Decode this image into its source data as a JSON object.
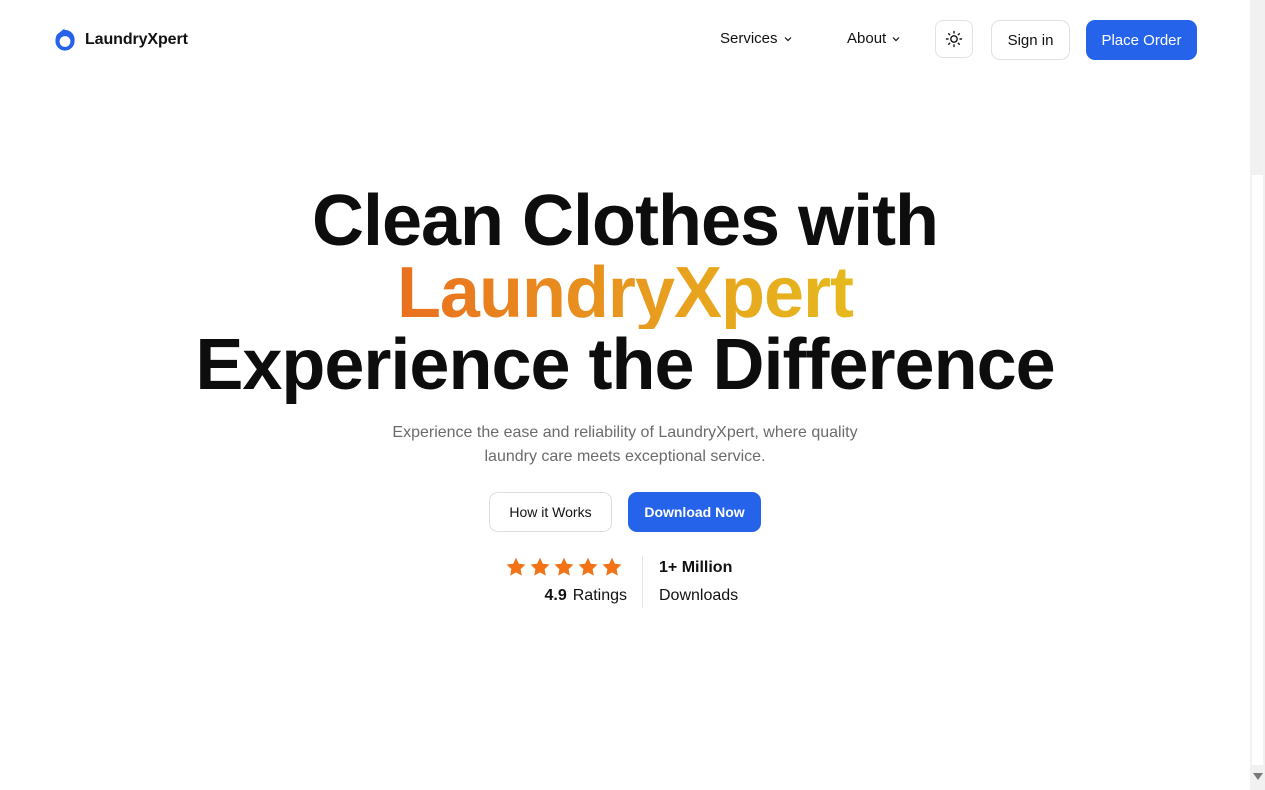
{
  "brand": {
    "name": "LaundryXpert",
    "logo_icon": "drop-ring-icon",
    "accent": "#2563eb"
  },
  "nav": {
    "items": [
      {
        "label": "Services",
        "icon": "chevron-down-icon"
      },
      {
        "label": "About",
        "icon": "chevron-down-icon"
      }
    ],
    "theme_toggle_icon": "sun-icon",
    "sign_in_label": "Sign in",
    "place_order_label": "Place Order"
  },
  "hero": {
    "title_line1": "Clean Clothes with",
    "title_line2": "LaundryXpert",
    "title_line3": "Experience the Difference",
    "subtitle": "Experience the ease and reliability of LaundryXpert, where quality laundry care meets exceptional service.",
    "secondary_button": "How it Works",
    "primary_button": "Download Now",
    "gradient_colors": [
      "#e41e1e",
      "#ea5a1f",
      "#e8a21e",
      "#e3cf1f",
      "#e1e31f"
    ]
  },
  "stats": {
    "stars": 5,
    "star_color": "#f47216",
    "rating_value": "4.9",
    "rating_label": "Ratings",
    "downloads_count": "1+ Million",
    "downloads_label": "Downloads"
  }
}
